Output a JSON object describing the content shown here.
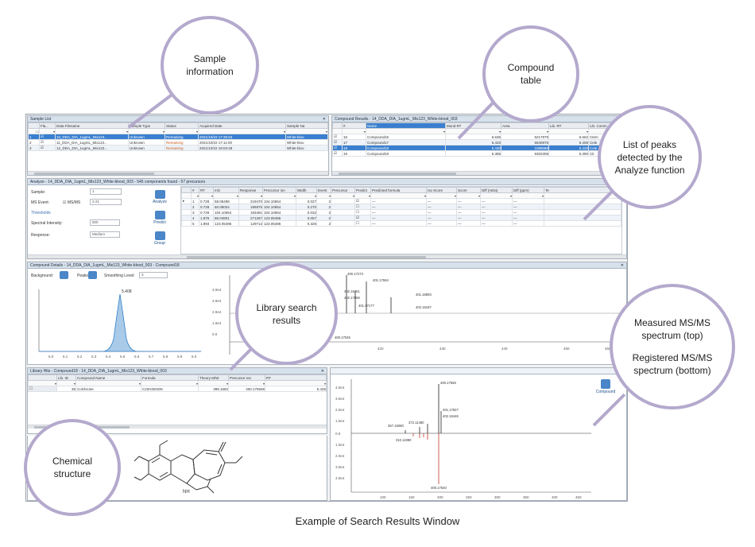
{
  "sample_list": {
    "title": "Sample List",
    "columns": [
      "",
      "Fla...",
      "Data Filename",
      "Sample Type",
      "Status",
      "Acquired Date",
      "Sample Na"
    ],
    "rows": [
      {
        "num": "1",
        "file": "10_DDA_DIA_1ugmL_Mix123...",
        "type": "Unknown",
        "status": "Remaining",
        "date": "2021/10/22 17:35:53",
        "name": "White-bloo"
      },
      {
        "num": "2",
        "file": "11_DDA_DIA_1ugmL_Mix123...",
        "type": "Unknown",
        "status": "Remaining",
        "date": "2021/10/22 17:11:00",
        "name": "White-bloo"
      },
      {
        "num": "3",
        "file": "12_DDA_DIA_1ugmL_Mix123...",
        "type": "Unknown",
        "status": "Remaining",
        "date": "2021/10/22 19:03:28",
        "name": "White-bloo"
      }
    ]
  },
  "compound_results": {
    "title": "Compound Results - 14_DDA_DIA_1ugmL_Mix123_White-blood_003",
    "columns": [
      "#",
      "Name",
      "Mond RT",
      "Area",
      "Lib. RT",
      "Lib. Comm"
    ],
    "rows": [
      {
        "num": "16",
        "name": "Compound16",
        "rt": "6.636",
        "area": "5217879",
        "lib_rt": "6.662",
        "comm": "Ctem"
      },
      {
        "num": "17",
        "name": "Compound17",
        "rt": "5.433",
        "area": "5940878",
        "lib_rt": "5.408",
        "comm": "Cele"
      },
      {
        "num": "18",
        "name": "Compound18",
        "rt": "5.430",
        "area": "1089089",
        "lib_rt": "5.426",
        "comm": "Cele"
      },
      {
        "num": "19",
        "name": "Compound19",
        "rt": "5.386",
        "area": "9302308",
        "lib_rt": "5.390",
        "comm": "Cit"
      }
    ]
  },
  "analyze": {
    "title": "Analyze - 14_DDA_DIA_1ugmL_Mix123_White-blood_003 - 545 components found - 57 precursors",
    "sample_label": "Sample:",
    "sample_value": "1",
    "ms_event_label": "MS Event:",
    "msms_label": "MS/MS",
    "ms_event_value": "2-21",
    "thresholds_label": "Thresholds",
    "spectral_label": "Spectral Intensity:",
    "spectral_value": "500",
    "response_label": "Response:",
    "response_value": "Medium",
    "buttons": [
      "Analyze",
      "Predict",
      "Group"
    ],
    "columns": [
      "#",
      "RT",
      "m/z",
      "Response",
      "Precursor ion",
      "Width",
      "Event",
      "Precursor",
      "Predict",
      "Predicted formula",
      "Iso Score",
      "Score",
      "Diff (mDa)",
      "Diff (ppm)",
      "Te"
    ],
    "rows": [
      {
        "num": "1",
        "rt": "0.728",
        "mz": "58.06498",
        "resp": "219470",
        "prec": "104.10654",
        "width": "0.027",
        "event": "2"
      },
      {
        "num": "2",
        "rt": "0.728",
        "mz": "60.08024",
        "resp": "185875",
        "prec": "104.10654",
        "width": "0.270",
        "event": "2"
      },
      {
        "num": "3",
        "rt": "0.729",
        "mz": "104.10654",
        "resp": "183481",
        "prec": "104.10654",
        "width": "0.032",
        "event": "2"
      },
      {
        "num": "4",
        "rt": "1.876",
        "mz": "86.04801",
        "resp": "271267",
        "prec": "123.05486",
        "width": "0.057",
        "event": "2"
      },
      {
        "num": "5",
        "rt": "1.893",
        "mz": "123.05486",
        "resp": "129712",
        "prec": "123.05486",
        "width": "0.326",
        "event": "2"
      }
    ]
  },
  "compound_details": {
    "title": "Compound Details - 14_DDA_DIA_1ugmL_Mix123_White-blood_003 - Compound18",
    "background_label": "Background:",
    "peaks_label": "Peaks:",
    "smoothing_label": "Smoothing Level:",
    "smoothing_value": "3",
    "chrom_x_ticks": [
      "5.0",
      "5.1",
      "5.2",
      "5.3",
      "5.4",
      "5.5",
      "5.6",
      "5.7",
      "5.8",
      "5.9",
      "6.0"
    ],
    "peak_label": "5.408",
    "ms_y_ticks": [
      "4.0e4",
      "3.0e4",
      "2.0e4",
      "1.0e4",
      "0.0"
    ],
    "ms_x_ticks": [
      "400",
      "410",
      "420",
      "430",
      "440",
      "450",
      "460"
    ],
    "ms_peak_labels": [
      "400.17273",
      "401.17594",
      "402.16451",
      "402.17056",
      "401.17177",
      "401.16893",
      "402.16187",
      "400.17045"
    ]
  },
  "library_hits": {
    "title": "Library Hits - Compound18 - 14_DDA_DIA_1ugmL_Mix123_White-blood_003",
    "columns": [
      "",
      "Lib. ID",
      "Compound Name",
      "Formula",
      "Theory M/W",
      "Precursor Ion",
      "RT"
    ],
    "row": {
      "id": "35",
      "name": "Colchicine",
      "formula": "C22H25NO6",
      "mw": "399.1682",
      "prec": "400.175506",
      "rt": "5.426"
    }
  },
  "msms": {
    "y_ticks": [
      "4.0e4",
      "3.0e4",
      "2.0e4",
      "1.0e4",
      "0.0",
      "1.0e4",
      "2.0e4",
      "3.0e4",
      "4.0e4"
    ],
    "x_ticks": [
      "100",
      "150",
      "200",
      "250",
      "300",
      "350",
      "400",
      "450"
    ],
    "peak_labels": [
      "400.17556",
      "401.17927",
      "372.11480",
      "357.15080",
      "310.11990",
      "402.16446",
      "400.17540"
    ],
    "compound_button": "Compound"
  },
  "callouts": {
    "sample_info": "Sample information",
    "compound_table": "Compound table",
    "peaks_list": "List of peaks detected by the Analyze function",
    "library_results": "Library search results",
    "measured": "Measured MS/MS spectrum (top)",
    "registered": "Registered MS/MS spectrum (bottom)",
    "chemical": "Chemical structure"
  },
  "caption": "Example of Search Results Window",
  "colors": {
    "callout_ring": "#b4a9cd",
    "selection": "#3a7fcf",
    "chromatogram": "#2f7fc6",
    "library_peak": "#c0392b"
  }
}
